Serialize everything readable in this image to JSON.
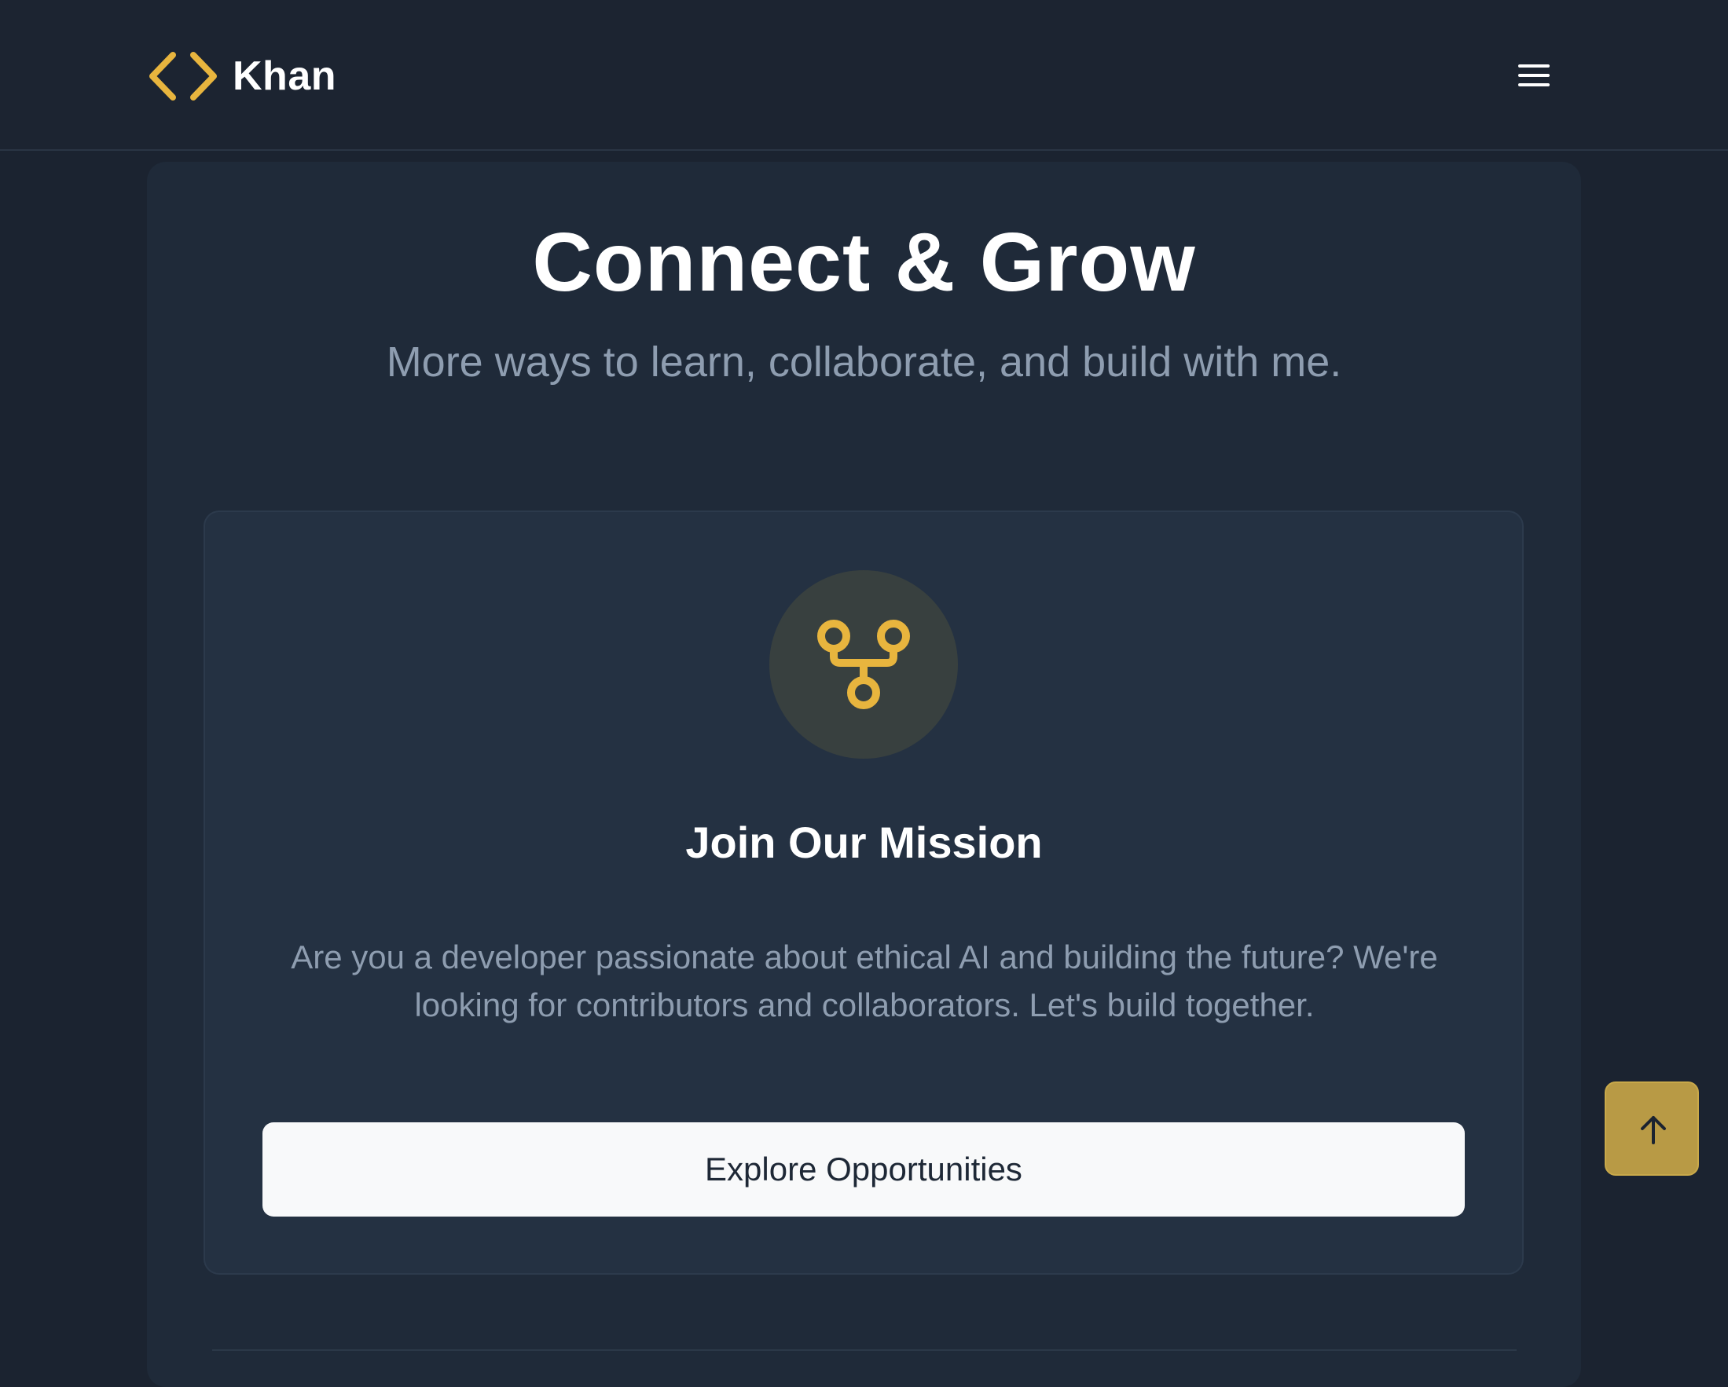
{
  "header": {
    "brand_name": "Khan",
    "brand_icon": "code-brackets-icon",
    "menu_icon": "hamburger-menu-icon"
  },
  "section": {
    "title": "Connect & Grow",
    "subtitle": "More ways to learn, collaborate, and build with me."
  },
  "card": {
    "icon": "git-fork-icon",
    "title": "Join Our Mission",
    "description": "Are you a developer passionate about ethical AI and building the future? We're looking for contributors and collaborators. Let's build together.",
    "button_label": "Explore Opportunities"
  },
  "scroll_top": {
    "icon": "arrow-up-icon"
  },
  "colors": {
    "accent": "#e8b53e",
    "background": "#1b2330",
    "card": "#243142",
    "button": "#f8f9fa",
    "scroll_top_bg": "#b89a45"
  }
}
